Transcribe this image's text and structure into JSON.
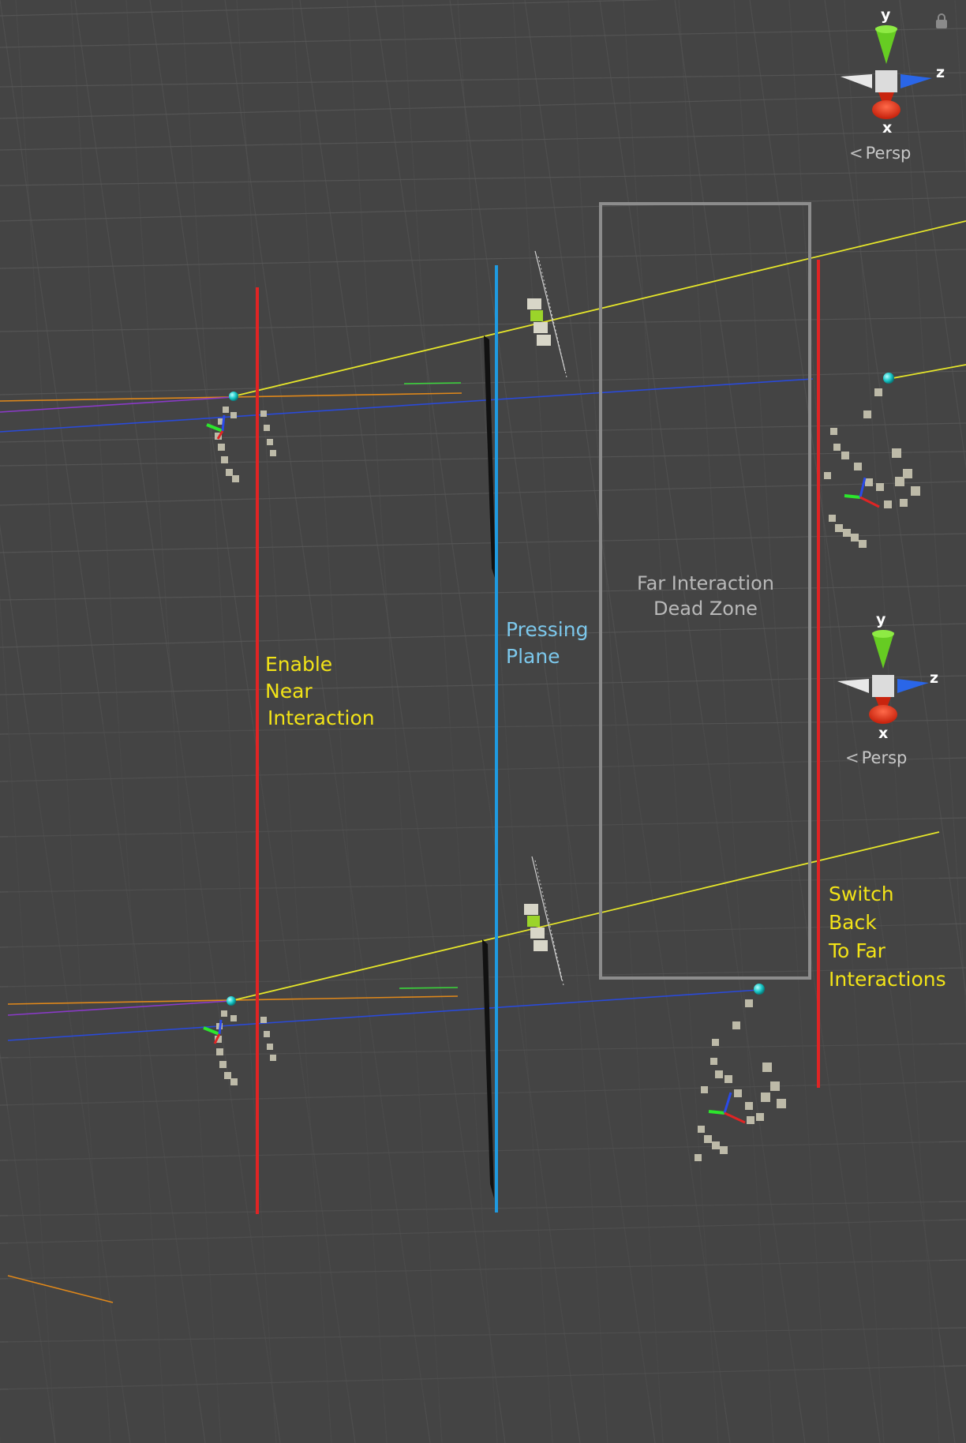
{
  "views": [
    {
      "name": "top",
      "gizmo": {
        "x_label": "x",
        "y_label": "y",
        "z_label": "z",
        "persp_label": "Persp"
      }
    },
    {
      "name": "bottom",
      "gizmo": {
        "x_label": "x",
        "y_label": "y",
        "z_label": "z",
        "persp_label": "Persp"
      }
    }
  ],
  "annotations": {
    "enable_near": [
      "Enable",
      "Near",
      "Interaction"
    ],
    "pressing_plane": [
      "Pressing",
      "Plane"
    ],
    "dead_zone": [
      "Far Interaction",
      "Dead Zone"
    ],
    "switch_back": [
      "Switch",
      "Back",
      "To Far",
      "Interactions"
    ]
  },
  "colors": {
    "background": "#444444",
    "grid": "#5a5a5a",
    "enable_line": "#e02424",
    "plane_line": "#1f9ae0",
    "dead_zone_box": "#8c8c8c",
    "annotation_text": "#f2e317",
    "plane_text": "#7cc8ec",
    "ray": "#e6e62a"
  },
  "icons": [
    "scene-gizmo-icon",
    "lock-icon",
    "hand-joint-icon",
    "finger-cursor-icon"
  ]
}
